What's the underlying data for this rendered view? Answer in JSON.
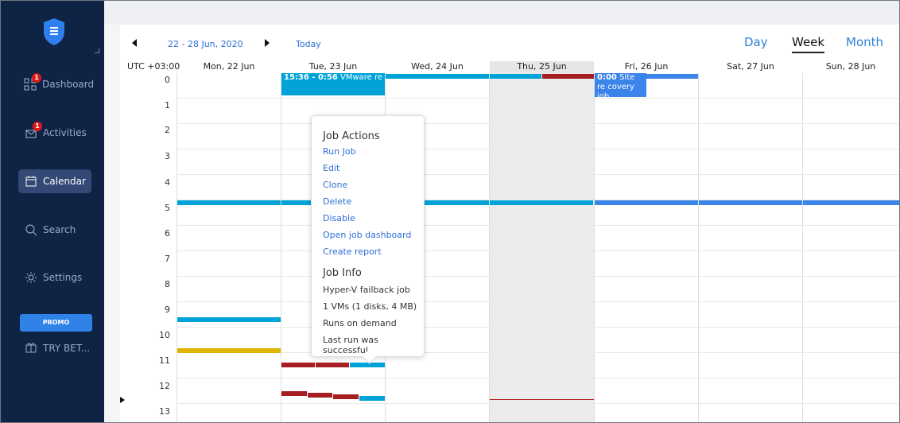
{
  "sidebar": {
    "items": [
      {
        "label": "Dashboard",
        "icon": "dashboard-grid-icon",
        "badge": "1"
      },
      {
        "label": "Activities",
        "icon": "activities-envelope-icon",
        "badge": "1"
      },
      {
        "label": "Calendar",
        "icon": "calendar-icon",
        "badge": null
      },
      {
        "label": "Search",
        "icon": "search-icon",
        "badge": null
      },
      {
        "label": "Settings",
        "icon": "settings-gear-icon",
        "badge": null
      }
    ],
    "promo": "PROMO",
    "try_beta": "TRY BET..."
  },
  "calendar": {
    "range": "22 - 28 Jun, 2020",
    "today": "Today",
    "views": [
      "Day",
      "Week",
      "Month"
    ],
    "active_view": "Week",
    "timezone": "UTC +03:00",
    "days": [
      "Mon, 22 Jun",
      "Tue, 23 Jun",
      "Wed, 24 Jun",
      "Thu, 25 Jun",
      "Fri, 26 Jun",
      "Sat, 27 Jun",
      "Sun, 28 Jun"
    ],
    "hours": [
      "0",
      "1",
      "2",
      "3",
      "4",
      "5",
      "6",
      "7",
      "8",
      "9",
      "10",
      "11",
      "12",
      "13"
    ],
    "events": [
      {
        "text": "15:36 - 0:56 VMware re",
        "time": "15:36 - 0:56",
        "title": "VMware re"
      },
      {
        "text": "0:00 Site recovery job",
        "time": "0:00",
        "title": "Site re covery job"
      }
    ],
    "popup": {
      "actions_title": "Job Actions",
      "actions": [
        "Run Job",
        "Edit",
        "Clone",
        "Delete",
        "Disable",
        "Open job dashboard",
        "Create report"
      ],
      "info_title": "Job Info",
      "info": [
        "Hyper-V failback job",
        "1 VMs (1 disks, 4 MB)",
        "Runs on demand",
        "Last run was successful"
      ]
    }
  },
  "colors": {
    "sidebar": "#0f2344",
    "active": "#334875",
    "blue": "#00a3d8",
    "bright_blue": "#3a84ea",
    "red": "#a61e22",
    "yellow": "#dfb500",
    "link": "#2f6fd6"
  }
}
